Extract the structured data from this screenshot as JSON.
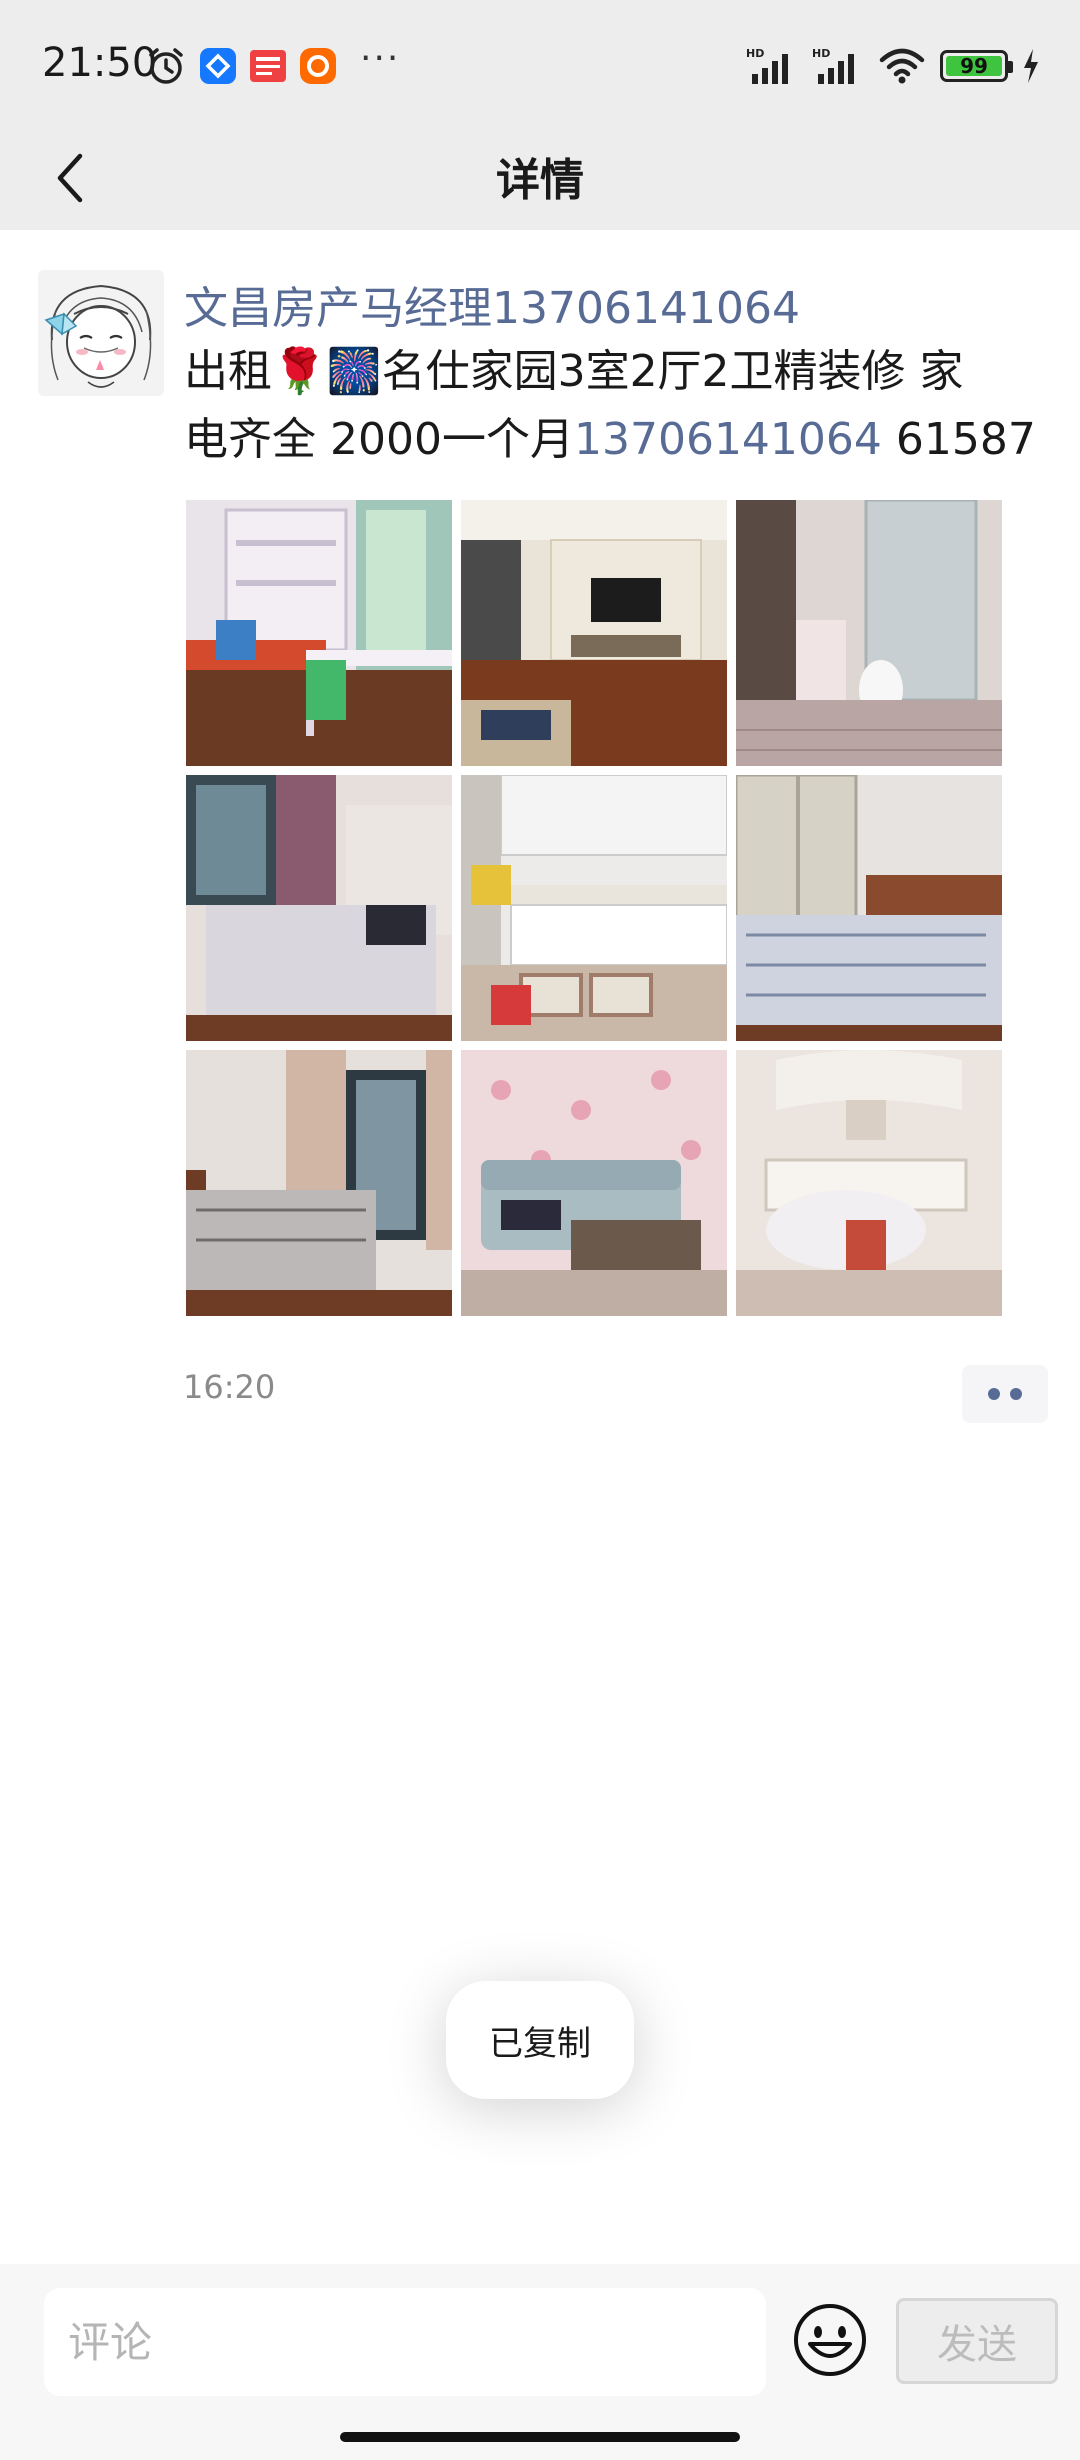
{
  "status_bar": {
    "time": "21:50",
    "left_icons": [
      "alarm-icon",
      "app-icon-blue",
      "toutiao-icon",
      "taobao-icon",
      "more-notifications-icon"
    ],
    "more": "···",
    "battery_level": "99",
    "right_icons": [
      "signal-hd-icon",
      "signal-hd-icon",
      "wifi-icon",
      "battery-icon",
      "charging-icon"
    ]
  },
  "nav": {
    "title": "详情",
    "back_icon": "chevron-left-icon"
  },
  "post": {
    "author": "文昌房产马经理13706141064",
    "text_line1": "出租🌹🎆名仕家园3室2厅2卫精装修 家",
    "text_line2_prefix": "电齐全 2000一个月",
    "text_phone": "13706141064",
    "text_line2_suffix": " 61587",
    "time": "16:20",
    "photos": [
      {
        "name": "photo-study-room"
      },
      {
        "name": "photo-living-room-tv"
      },
      {
        "name": "photo-bathroom"
      },
      {
        "name": "photo-bedroom-1"
      },
      {
        "name": "photo-kitchen"
      },
      {
        "name": "photo-bedroom-2"
      },
      {
        "name": "photo-bedroom-3"
      },
      {
        "name": "photo-living-room-sofa"
      },
      {
        "name": "photo-dining-room"
      }
    ]
  },
  "toast": {
    "text": "已复制"
  },
  "comment_bar": {
    "placeholder": "评论",
    "send_label": "发送",
    "emoji_icon": "smiley-icon"
  },
  "colors": {
    "link_blue": "#576b95",
    "bar_gray": "#ededed",
    "battery_green": "#3ec43e"
  }
}
